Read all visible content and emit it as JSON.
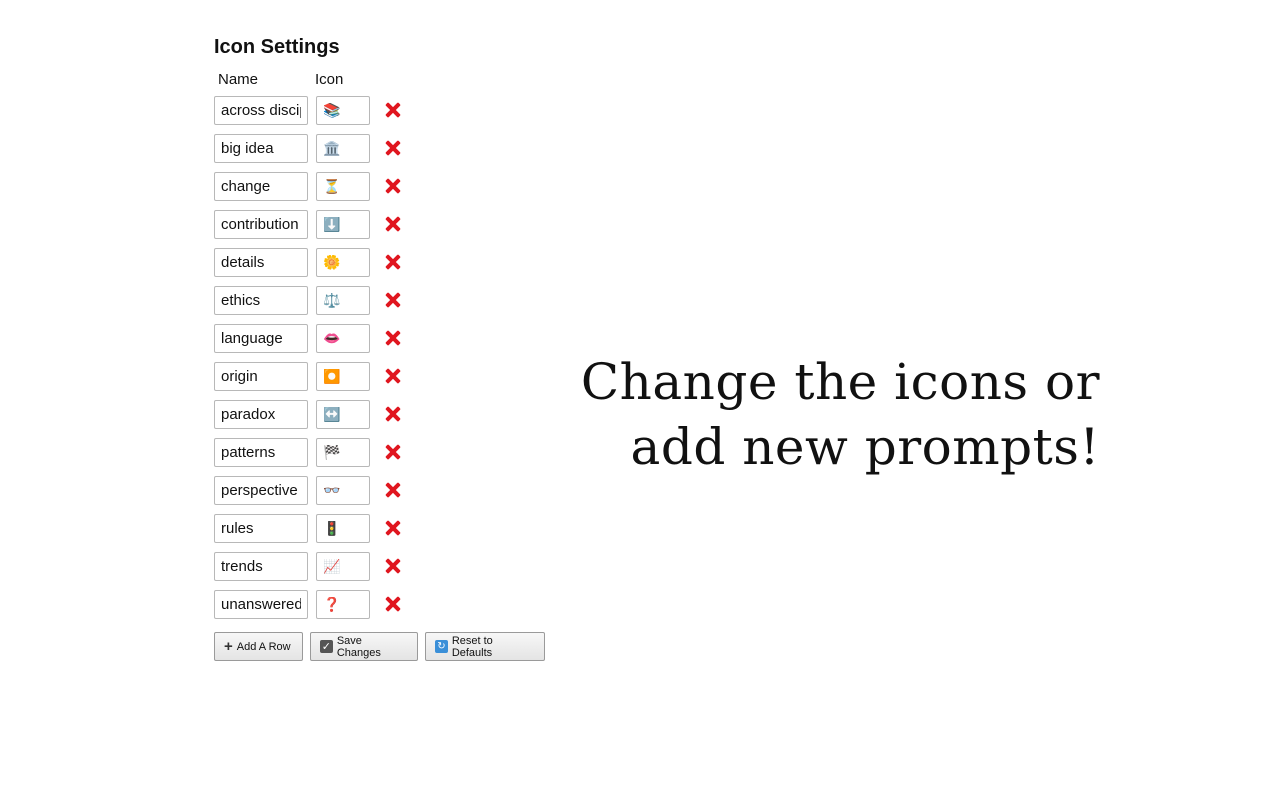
{
  "page": {
    "title": "Icon Settings"
  },
  "columns": {
    "name": "Name",
    "icon": "Icon"
  },
  "rows": [
    {
      "name": "across disciplines",
      "icon": "📚"
    },
    {
      "name": "big idea",
      "icon": "🏛️"
    },
    {
      "name": "change",
      "icon": "⏳"
    },
    {
      "name": "contribution",
      "icon": "⬇️"
    },
    {
      "name": "details",
      "icon": "🌼"
    },
    {
      "name": "ethics",
      "icon": "⚖️"
    },
    {
      "name": "language",
      "icon": "👄"
    },
    {
      "name": "origin",
      "icon": "⏺️"
    },
    {
      "name": "paradox",
      "icon": "↔️"
    },
    {
      "name": "patterns",
      "icon": "🏁"
    },
    {
      "name": "perspective",
      "icon": "👓"
    },
    {
      "name": "rules",
      "icon": "🚦"
    },
    {
      "name": "trends",
      "icon": "📈"
    },
    {
      "name": "unanswered questions",
      "icon": "❓"
    }
  ],
  "buttons": {
    "add": "Add A Row",
    "save": "Save Changes",
    "reset": "Reset to Defaults"
  },
  "icons": {
    "add": "plus-icon",
    "save": "checkbox-icon",
    "reset": "refresh-icon",
    "delete": "close-icon"
  },
  "colors": {
    "delete": "#e0161f"
  },
  "promo": {
    "line1": "Change the icons or",
    "line2": "add new prompts!"
  }
}
